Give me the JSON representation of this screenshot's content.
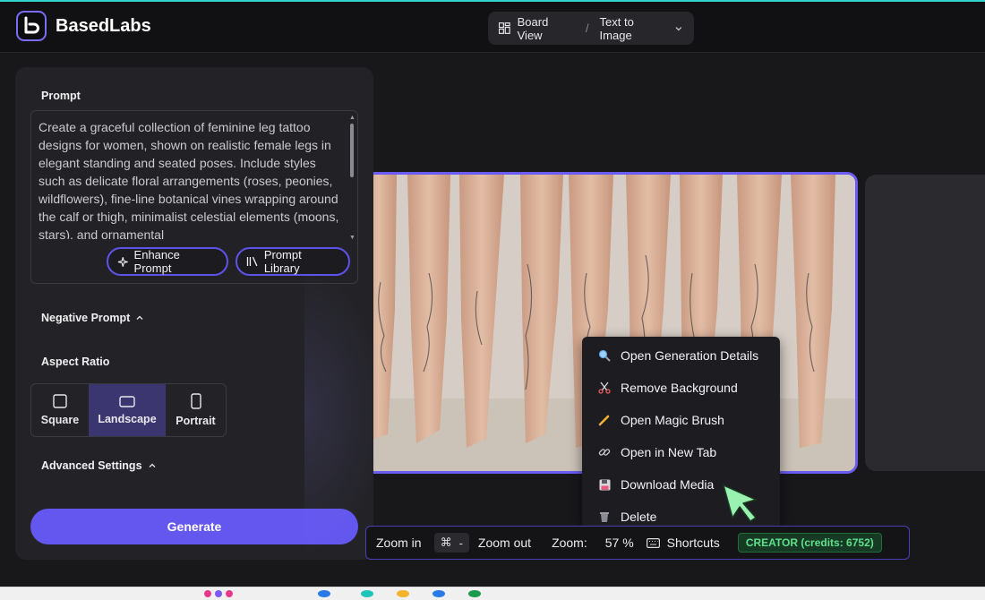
{
  "header": {
    "brand": "BasedLabs",
    "breadcrumb": {
      "view": "Board View",
      "separator": "/",
      "mode": "Text to Image"
    }
  },
  "panel": {
    "prompt_label": "Prompt",
    "prompt_text": "Create a graceful collection of feminine leg tattoo designs for women, shown on realistic female legs in elegant standing and seated poses. Include styles such as delicate floral arrangements (roses, peonies, wildflowers), fine-line botanical vines wrapping around the calf or thigh, minimalist celestial elements (moons, stars), and ornamental",
    "enhance_label": "Enhance Prompt",
    "library_label": "Prompt Library",
    "negative_label": "Negative Prompt",
    "aspect_label": "Aspect Ratio",
    "aspect_options": [
      {
        "label": "Square",
        "selected": false
      },
      {
        "label": "Landscape",
        "selected": true
      },
      {
        "label": "Portrait",
        "selected": false
      }
    ],
    "advanced_label": "Advanced Settings",
    "generate_label": "Generate"
  },
  "context_menu": {
    "items": [
      {
        "label": "Open Generation Details",
        "icon": "magnifier-icon"
      },
      {
        "label": "Remove Background",
        "icon": "scissors-icon"
      },
      {
        "label": "Open Magic Brush",
        "icon": "pencil-icon"
      },
      {
        "label": "Open in New Tab",
        "icon": "link-icon"
      },
      {
        "label": "Download Media",
        "icon": "floppy-disk-icon"
      },
      {
        "label": "Delete",
        "icon": "trash-icon"
      }
    ]
  },
  "toolbar": {
    "zoom_in": "Zoom in",
    "zoom_out_key": "⌘",
    "zoom_out_key2": "-",
    "zoom_out": "Zoom out",
    "zoom_label": "Zoom:",
    "zoom_value": "57 %",
    "shortcuts": "Shortcuts",
    "plan_badge": "CREATOR (credits: 6752)"
  },
  "colors": {
    "accent": "#6457f0",
    "background": "#18181b",
    "panel": "#232327",
    "badge_green": "#5ee08b",
    "cursor": "#9af2b0"
  }
}
